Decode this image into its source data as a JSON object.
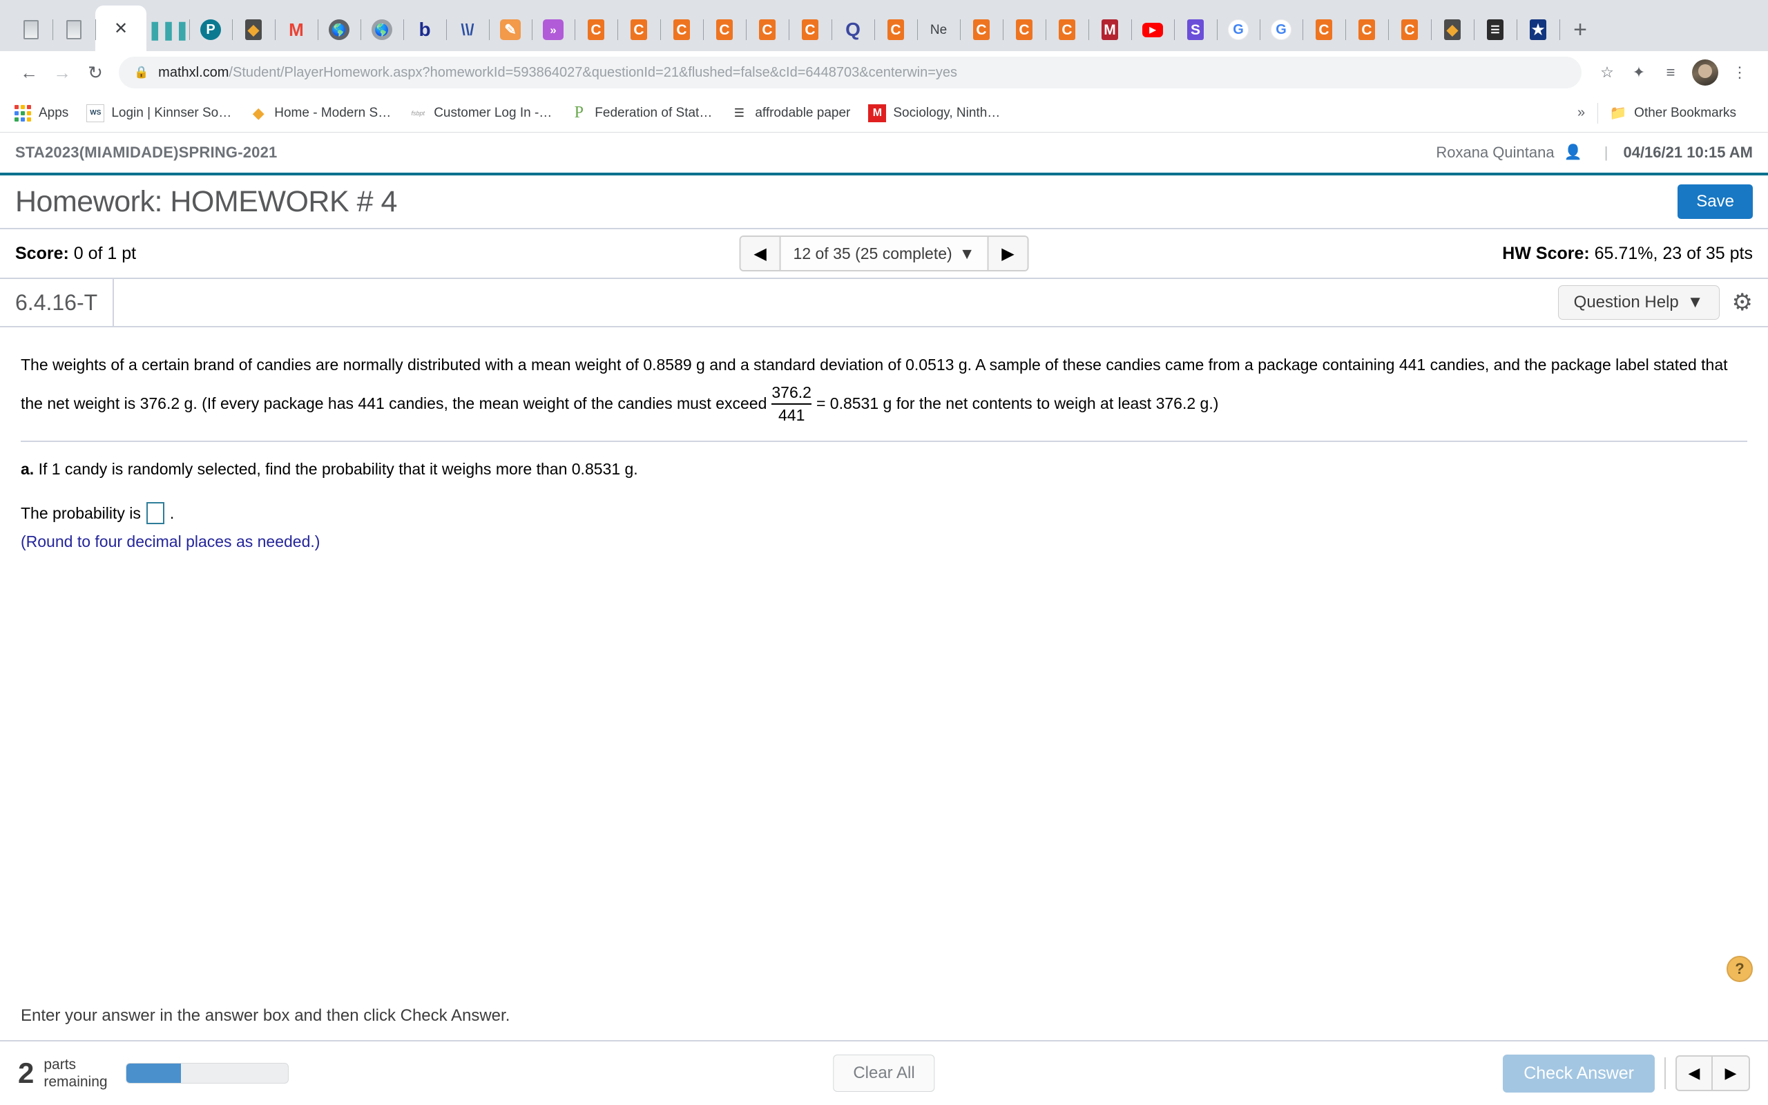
{
  "browser": {
    "tabs": [
      {
        "name": "doc-tab-1",
        "glyph": "Ὄ4",
        "type": "doc",
        "color": "#bfc4c9"
      },
      {
        "name": "doc-tab-2",
        "glyph": "Ὄ4",
        "type": "doc",
        "color": "#bfc4c9"
      },
      {
        "name": "active-tab",
        "glyph": "X",
        "type": "active",
        "color": "#3c4043"
      },
      {
        "name": "bars-tab",
        "glyph": "|||",
        "type": "bars",
        "color": "#3aa7ab"
      },
      {
        "name": "pearson-tab",
        "glyph": "P",
        "type": "circle",
        "color": "#0b7a91"
      },
      {
        "name": "modernstar-tab",
        "glyph": "◆",
        "type": "sq",
        "color": "#4c4c4c"
      },
      {
        "name": "gmail-tab",
        "glyph": "M",
        "type": "gmail",
        "color": "#ea4335"
      },
      {
        "name": "globe-tab-1",
        "glyph": "ἱ0",
        "type": "globe",
        "color": "#5f6368"
      },
      {
        "name": "globe-tab-2",
        "glyph": "ἱ0",
        "type": "globe",
        "color": "#9aa0a6"
      },
      {
        "name": "blackboard-tab",
        "glyph": "b",
        "type": "text",
        "color": "#1b2b8f"
      },
      {
        "name": "vn-tab",
        "glyph": "VɈ",
        "type": "text",
        "color": "#2b4fa2"
      },
      {
        "name": "pencil-tab",
        "glyph": "✎",
        "type": "sq",
        "color": "#f2994a"
      },
      {
        "name": "purple-tab",
        "glyph": "»",
        "type": "sq",
        "color": "#b15bd8"
      },
      {
        "name": "canvas-tab-1",
        "glyph": "C",
        "type": "sq",
        "color": "#ee7420"
      },
      {
        "name": "canvas-tab-2",
        "glyph": "C",
        "type": "sq",
        "color": "#ee7420"
      },
      {
        "name": "canvas-tab-3",
        "glyph": "C",
        "type": "sq",
        "color": "#ee7420"
      },
      {
        "name": "canvas-tab-4",
        "glyph": "C",
        "type": "sq",
        "color": "#ee7420"
      },
      {
        "name": "canvas-tab-5",
        "glyph": "C",
        "type": "sq",
        "color": "#ee7420"
      },
      {
        "name": "canvas-tab-6",
        "glyph": "C",
        "type": "sq",
        "color": "#ee7420"
      },
      {
        "name": "quizlet-tab",
        "glyph": "Q",
        "type": "text",
        "color": "#3b48a0"
      },
      {
        "name": "canvas-tab-7",
        "glyph": "C",
        "type": "sq",
        "color": "#ee7420"
      },
      {
        "name": "new-tab-label",
        "glyph": "Ne",
        "type": "label",
        "color": "#3c4043"
      },
      {
        "name": "canvas-tab-8",
        "glyph": "C",
        "type": "sq",
        "color": "#ee7420"
      },
      {
        "name": "canvas-tab-9",
        "glyph": "C",
        "type": "sq",
        "color": "#ee7420"
      },
      {
        "name": "canvas-tab-10",
        "glyph": "C",
        "type": "sq",
        "color": "#ee7420"
      },
      {
        "name": "mheducation-tab",
        "glyph": "M",
        "type": "sq",
        "color": "#b32430"
      },
      {
        "name": "youtube-tab",
        "glyph": "▶",
        "type": "yt",
        "color": "#ff0000"
      },
      {
        "name": "s-tab",
        "glyph": "S",
        "type": "sq",
        "color": "#6b4fd8"
      },
      {
        "name": "google-tab-1",
        "glyph": "G",
        "type": "google",
        "color": "#4285f4"
      },
      {
        "name": "google-tab-2",
        "glyph": "G",
        "type": "google",
        "color": "#4285f4"
      },
      {
        "name": "canvas-tab-11",
        "glyph": "C",
        "type": "sq",
        "color": "#ee7420"
      },
      {
        "name": "canvas-tab-12",
        "glyph": "C",
        "type": "sq",
        "color": "#ee7420"
      },
      {
        "name": "canvas-tab-13",
        "glyph": "C",
        "type": "sq",
        "color": "#ee7420"
      },
      {
        "name": "modernstar-tab-2",
        "glyph": "◆",
        "type": "sq",
        "color": "#4c4c4c"
      },
      {
        "name": "doc-tab-3",
        "glyph": "☰",
        "type": "sq",
        "color": "#2b2b2b"
      },
      {
        "name": "star-tab",
        "glyph": "★",
        "type": "shield",
        "color": "#12357f"
      }
    ],
    "new_tab_label": "+",
    "nav": {
      "back": "←",
      "forward": "→",
      "reload": "↻"
    },
    "omnibox": {
      "lock_icon": "lock-icon",
      "url_host": "mathxl.com",
      "url_path": "/Student/PlayerHomework.aspx?homeworkId=593864027&questionId=21&flushed=false&cId=6448703&centerwin=yes"
    },
    "toolbar_icons": {
      "bookmark_star": "☆",
      "extensions": "✦",
      "reading_list": "≡",
      "menu": "⋮"
    },
    "bookmarks": [
      {
        "label": "Apps",
        "icon": "apps-grid-icon"
      },
      {
        "label": "Login | Kinnser So…",
        "icon": "kinnser-icon",
        "glyph": "WS",
        "color": "#2b4a63"
      },
      {
        "label": "Home - Modern S…",
        "icon": "modernstar-icon",
        "glyph": "◆",
        "color": "#f0a830"
      },
      {
        "label": "Customer Log In -…",
        "icon": "fsbpt-icon",
        "glyph": "fsbpt",
        "color": "#aaaaaa"
      },
      {
        "label": "Federation of Stat…",
        "icon": "pearson-p-icon",
        "glyph": "P",
        "color": "#6aa84f"
      },
      {
        "label": "affrodable paper",
        "icon": "document-icon",
        "glyph": "☰",
        "color": "#2b2b2b"
      },
      {
        "label": "Sociology, Ninth…",
        "icon": "mheducation-icon",
        "glyph": "M",
        "color": "#e02020"
      }
    ],
    "bookmarks_overflow": "»",
    "other_bookmarks": {
      "label": "Other Bookmarks",
      "icon": "folder-icon"
    }
  },
  "mathxl": {
    "course_title": "STA2023(MIAMIDADE)SPRING-2021",
    "user_name": "Roxana Quintana",
    "user_icon": "person-icon",
    "divider": "|",
    "datetime": "04/16/21 10:15 AM",
    "homework_title": "Homework: HOMEWORK # 4",
    "save_label": "Save",
    "score_label": "Score:",
    "score_value": "0 of 1 pt",
    "pager": {
      "prev": "◀",
      "next": "▶",
      "label": "12 of 35 (25 complete)",
      "caret": "▼"
    },
    "hw_score_label": "HW Score:",
    "hw_score_value": "65.71%, 23 of 35 pts",
    "question_id": "6.4.16-T",
    "question_help_label": "Question Help",
    "question_help_caret": "▼",
    "settings_icon": "gear-icon",
    "question": {
      "line1_a": "The weights of a certain brand of candies are normally distributed with a mean weight of 0.8589 g and a standard deviation of 0.0513 g. A sample of these candies came from a package containing 441 candies, and",
      "line2_a": "the package label stated that the net weight is 376.2 g. (If every package has 441 candies, the mean weight of the candies must exceed",
      "frac_num": "376.2",
      "frac_den": "441",
      "line2_b": "= 0.8531 g for the net contents to weigh at least 376.2 g.)"
    },
    "part_a_marker": "a.",
    "part_a_text": "If 1 candy is randomly selected, find the probability that it weighs more than 0.8531 g.",
    "answer_prompt": "The probability is",
    "answer_value": "",
    "answer_period": ".",
    "round_note": "(Round to four decimal places as needed.)",
    "help_bubble": "?",
    "instruction": "Enter your answer in the answer box and then click Check Answer.",
    "footer": {
      "parts_count": "2",
      "parts_label_line1": "parts",
      "parts_label_line2": "remaining",
      "progress_percent": 34,
      "clear_all_label": "Clear All",
      "check_answer_label": "Check Answer",
      "prev": "◀",
      "next": "▶"
    }
  },
  "colors": {
    "accent_teal": "#00718f",
    "save_blue": "#1878c4",
    "check_blue": "#a3c6e2",
    "progress_blue": "#4a90cd",
    "note_navy": "#24259a",
    "answer_box_border": "#2e7d99"
  }
}
